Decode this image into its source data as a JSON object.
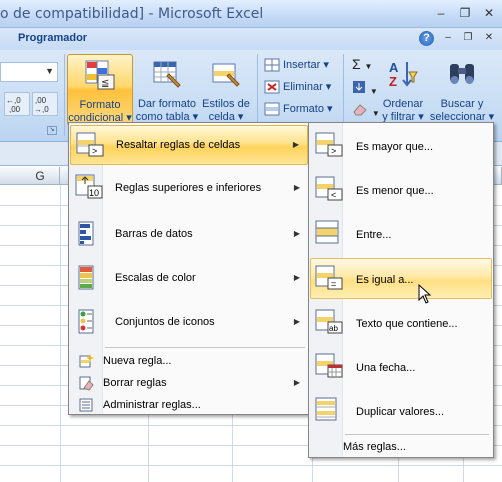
{
  "window": {
    "title": "o de compatibilidad] - Microsoft Excel",
    "controls": {
      "minimize": "–",
      "restore": "❐",
      "close": "✕"
    }
  },
  "tabs": {
    "visible_tab": "Programador",
    "help": "?"
  },
  "ribbon": {
    "decimal_increase": "←,0 ,00",
    "decimal_decrease": ",00 →,0",
    "conditional_format": {
      "line1": "Formato",
      "line2": "condicional ▾"
    },
    "format_as_table": {
      "line1": "Dar formato",
      "line2": "como tabla ▾"
    },
    "cell_styles": {
      "line1": "Estilos de",
      "line2": "celda ▾"
    },
    "insert": "Insertar ▾",
    "delete": "Eliminar ▾",
    "format": "Formato ▾",
    "sort_filter": {
      "line1": "Ordenar",
      "line2": "y filtrar ▾"
    },
    "find_select": {
      "line1": "Buscar y",
      "line2": "seleccionar ▾"
    }
  },
  "grid": {
    "column_label": "G"
  },
  "main_menu": {
    "items": [
      {
        "label": "Resaltar reglas de celdas",
        "underline": "R",
        "has_submenu": true,
        "highlighted": true
      },
      {
        "label": "Reglas superiores e inferiores",
        "underline": "S",
        "has_submenu": true
      },
      {
        "label": "Barras de datos",
        "underline": "B",
        "has_submenu": true
      },
      {
        "label": "Escalas de color",
        "underline": "s",
        "has_submenu": true
      },
      {
        "label": "Conjuntos de iconos",
        "underline": "C",
        "has_submenu": true
      }
    ],
    "small_items": [
      {
        "label": "Nueva regla...",
        "underline": "N"
      },
      {
        "label": "Borrar reglas",
        "underline": "B",
        "has_submenu": true
      },
      {
        "label": "Administrar reglas...",
        "underline": "r"
      }
    ]
  },
  "sub_menu": {
    "items": [
      {
        "label": "Es mayor que..."
      },
      {
        "label": "Es menor que..."
      },
      {
        "label": "Entre..."
      },
      {
        "label": "Es igual a...",
        "highlighted": true
      },
      {
        "label": "Texto que contiene..."
      },
      {
        "label": "Una fecha..."
      },
      {
        "label": "Duplicar valores..."
      }
    ],
    "more_rules": "Más reglas..."
  },
  "colors": {
    "accent_highlight": "#ffd35b",
    "ribbon_blue": "#c6dcf4",
    "text_blue": "#15428b"
  }
}
